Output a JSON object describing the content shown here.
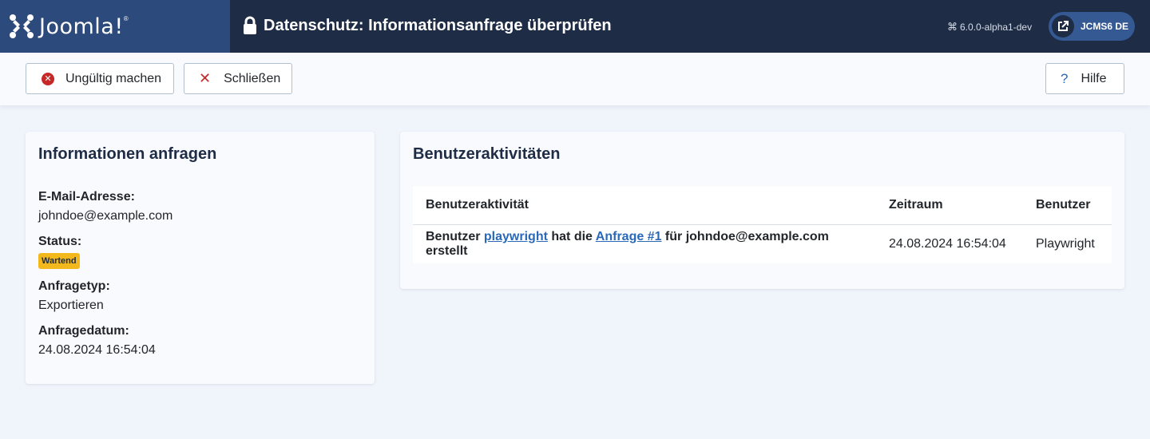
{
  "header": {
    "logo_text": "Joomla!",
    "logo_reg": "®",
    "page_title": "Datenschutz: Informationsanfrage überprüfen",
    "version": "6.0.0-alpha1-dev",
    "version_icon": "⌘",
    "site_label": "JCMS6 DE"
  },
  "toolbar": {
    "invalidate_label": "Ungültig machen",
    "close_label": "Schließen",
    "help_label": "Hilfe"
  },
  "request": {
    "heading": "Informationen anfragen",
    "email_label": "E-Mail-Adresse:",
    "email_value": "johndoe@example.com",
    "status_label": "Status:",
    "status_value": "Wartend",
    "type_label": "Anfragetyp:",
    "type_value": "Exportieren",
    "date_label": "Anfragedatum:",
    "date_value": "24.08.2024 16:54:04"
  },
  "activities": {
    "heading": "Benutzeraktivitäten",
    "columns": [
      "Benutzeraktivität",
      "Zeitraum",
      "Benutzer"
    ],
    "rows": [
      {
        "prefix": "Benutzer ",
        "user_link": "playwright",
        "middle": " hat die ",
        "request_link": "Anfrage #1",
        "suffix": " für johndoe@example.com erstellt",
        "date": "24.08.2024 16:54:04",
        "user": "Playwright"
      }
    ]
  },
  "colors": {
    "header_bg": "#1e2c45",
    "brand_bg": "#2c4a7c",
    "danger": "#c52827",
    "link": "#2a69b8",
    "badge_warning": "#f2b81c"
  }
}
